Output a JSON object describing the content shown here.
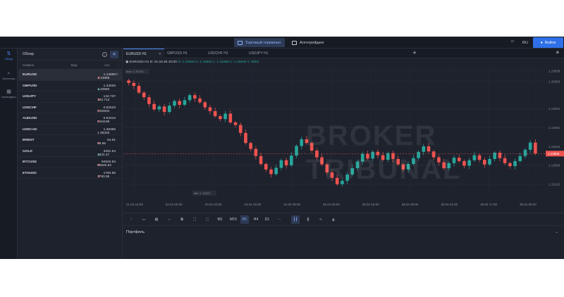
{
  "header": {
    "terminal_label": "Торговый терминал",
    "algo_label": "Алготрейдинг",
    "lang": "RU",
    "login_label": "Войти"
  },
  "nav": {
    "items": [
      {
        "label": "Обзор",
        "icon": "market-overview-icon"
      },
      {
        "label": "Прогнозы",
        "icon": "search-icon"
      },
      {
        "label": "Календарь",
        "icon": "calendar-icon"
      }
    ]
  },
  "watchlist": {
    "title": "Обзор",
    "columns": {
      "symbol": "Символ",
      "bid": "Бид",
      "ask": "Аск"
    },
    "rows": [
      {
        "symbol": "EURUSD",
        "dir": "down",
        "bid": "1.13868",
        "ask": "1.13889"
      },
      {
        "symbol": "GBPUSD",
        "dir": "up",
        "bid": "1.33992",
        "ask": "1.34026"
      },
      {
        "symbol": "USDJPY",
        "dir": "down",
        "bid": "142.713",
        "ask": "142.737"
      },
      {
        "symbol": "USDCHF",
        "dir": "down",
        "bid": "0.82504",
        "ask": "0.82533"
      },
      {
        "symbol": "AUDUSD",
        "dir": "down",
        "bid": "0.64199",
        "ask": "0.64216"
      },
      {
        "symbol": "USDCAD",
        "dir": "none",
        "bid": "1.38325",
        "ask": "1.38356"
      },
      {
        "symbol": "BRENT",
        "dir": "down",
        "bid": "64.86",
        "ask": "64.91"
      },
      {
        "symbol": "GOLD",
        "dir": "up",
        "bid": "3331.47",
        "ask": "3331.64"
      },
      {
        "symbol": "BTCUSD",
        "dir": "down",
        "bid": "94540.82",
        "ask": "94540.83"
      },
      {
        "symbol": "ETHUSD",
        "dir": "down",
        "bid": "1783.95",
        "ask": "1783.96"
      }
    ]
  },
  "tabs": [
    "EURUSD H1",
    "GBPUSD H1",
    "USDCHF H1",
    "USDJPY H1"
  ],
  "chart": {
    "legend_symbol": "EURUSD",
    "legend_tf": "H1",
    "legend_date": "D: 21.04.25 10:00",
    "legend_ohlc": "O: 1.15534  H: 1.15666  L: 1.15489  C: 1.15548  V: 8003",
    "watermark_1": "BROKER",
    "watermark_2": "TRIBUNAL",
    "max_label": "Max: 1.15724",
    "min_label": "Min: 1.12875",
    "current_price": "1.13868",
    "y_ticks": [
      "1.15839",
      "1.15593",
      "1.14941",
      "1.14491",
      "1.14042",
      "1.13593",
      "1.13142"
    ],
    "x_ticks": [
      "21.04 16:00",
      "22.04 00:00",
      "23.04 02:00",
      "23.04 16:00",
      "24.04 08:00",
      "25.04 00:00",
      "25.04 16:00",
      "28.04 08:00",
      "29.04 01:00",
      "29.04 17:00",
      "30.04 09:00"
    ],
    "up_color": "#26a69a",
    "down_color": "#ef5350"
  },
  "toolbar": {
    "timeframes": [
      "M1",
      "M15",
      "H1",
      "H4",
      "D1"
    ],
    "active_tf": "H1",
    "more": "···"
  },
  "portfolio": {
    "title": "Портфель"
  },
  "chart_data": {
    "type": "candlestick",
    "symbol": "EURUSD",
    "timeframe": "H1",
    "ylim": [
      1.1285,
      1.1595
    ],
    "close_series": [
      1.1555,
      1.1548,
      1.1532,
      1.1521,
      1.1505,
      1.1492,
      1.1499,
      1.1486,
      1.1501,
      1.1512,
      1.1503,
      1.1514,
      1.1526,
      1.1518,
      1.1509,
      1.1497,
      1.1488,
      1.1476,
      1.1469,
      1.1482,
      1.1461,
      1.1455,
      1.1436,
      1.1412,
      1.1398,
      1.1381,
      1.1362,
      1.1349,
      1.1338,
      1.1353,
      1.1371,
      1.1359,
      1.1382,
      1.1405,
      1.1421,
      1.1412,
      1.1394,
      1.1378,
      1.1361,
      1.1342,
      1.1329,
      1.1314,
      1.1322,
      1.1337,
      1.1352,
      1.1368,
      1.1386,
      1.1375,
      1.1391,
      1.1383,
      1.1372,
      1.1388,
      1.1374,
      1.1361,
      1.1349,
      1.1362,
      1.1376,
      1.1391,
      1.1404,
      1.1392,
      1.1378,
      1.1366,
      1.1352,
      1.1364,
      1.1377,
      1.1369,
      1.1358,
      1.1371,
      1.1383,
      1.1372,
      1.1361,
      1.1374,
      1.1389,
      1.1376,
      1.1364,
      1.1357,
      1.1369,
      1.1381,
      1.1396,
      1.1413,
      1.1387
    ]
  }
}
